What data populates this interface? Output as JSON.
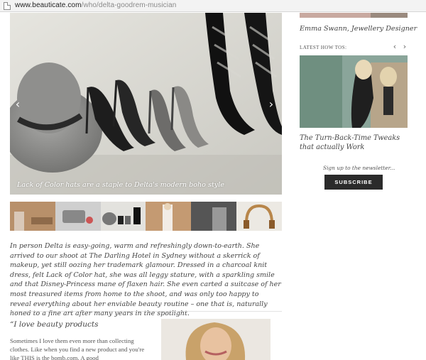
{
  "browser": {
    "url_host": "www.beauticate.com",
    "url_path": "/who/delta-goodrem-musician"
  },
  "hero": {
    "caption": "Lack of Color hats are a staple to Delta's modern boho style",
    "prev_icon": "chevron-left-icon",
    "next_icon": "chevron-right-icon"
  },
  "thumbnails": [
    {
      "name": "thumb-living-room"
    },
    {
      "name": "thumb-makeup-bag"
    },
    {
      "name": "thumb-shoes"
    },
    {
      "name": "thumb-dress"
    },
    {
      "name": "thumb-bw-portrait"
    },
    {
      "name": "thumb-headphones"
    }
  ],
  "article": {
    "intro": "In person Delta is easy-going, warm and refreshingly down-to-earth. She arrived to our shoot at The Darling Hotel in Sydney without a skerrick of makeup, yet still oozing her trademark glamour. Dressed in a charcoal knit dress, felt Lack of Color hat, she was all leggy stature, with a sparkling smile and that Disney-Princess mane of flaxen hair. She even carted a suitcase of her most treasured items from home to the shoot, and was only too happy to reveal everything about her enviable beauty routine – one that is, naturally honed to a fine art after many years in the spotlight.",
    "quote_heading": "“I love beauty products",
    "paragraph2": "Sometimes I love them even more than collecting clothes. Like when you find a new product and you're like THIS is the bomb.com. A good"
  },
  "sidebar": {
    "designer_caption": "Emma Swann, Jewellery Designer",
    "latest_label": "LATEST HOW TOS:",
    "prev_icon": "chevron-left-icon",
    "next_icon": "chevron-right-icon",
    "article_title": "The Turn-Back-Time Tweaks that actually Work",
    "newsletter_text": "Sign up to the newsletter...",
    "subscribe_label": "SUBSCRIBE"
  },
  "colors": {
    "subscribe_bg": "#2b2b2b",
    "text": "#444444"
  }
}
